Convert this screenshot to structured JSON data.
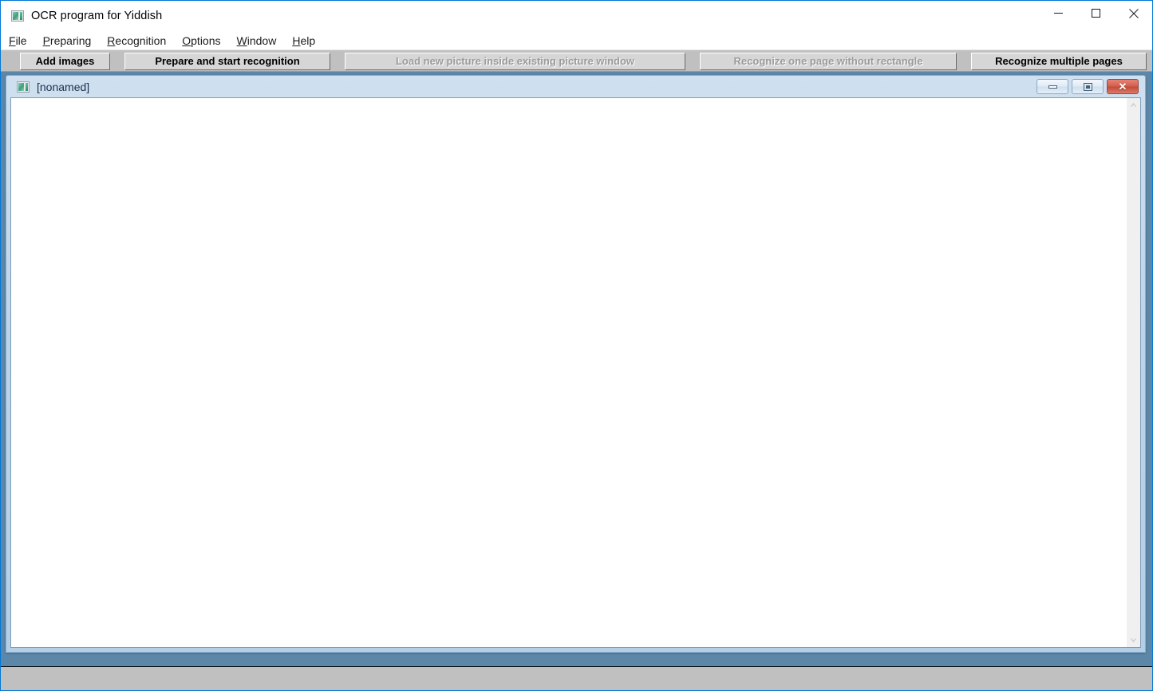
{
  "window": {
    "title": "OCR program for Yiddish",
    "icon": "picture-icon",
    "controls": [
      {
        "name": "minimize",
        "glyph": "—"
      },
      {
        "name": "maximize",
        "glyph": "□"
      },
      {
        "name": "close",
        "glyph": "✕"
      }
    ]
  },
  "menubar": {
    "items": [
      {
        "label": "File",
        "accel": "F"
      },
      {
        "label": "Preparing",
        "accel": "P"
      },
      {
        "label": "Recognition",
        "accel": "R"
      },
      {
        "label": "Options",
        "accel": "O"
      },
      {
        "label": "Window",
        "accel": "W"
      },
      {
        "label": "Help",
        "accel": "H"
      }
    ]
  },
  "toolbar": {
    "buttons": [
      {
        "label": "Add images",
        "enabled": true
      },
      {
        "label": "Prepare and start recognition",
        "enabled": true
      },
      {
        "label": "Load new picture inside existing picture window",
        "enabled": false
      },
      {
        "label": "Recognize one page without rectangle",
        "enabled": false
      },
      {
        "label": "Recognize multiple pages",
        "enabled": true
      }
    ]
  },
  "mdi_child": {
    "title": "[nonamed]",
    "icon": "picture-icon",
    "controls": [
      {
        "name": "minimize",
        "glyph": ""
      },
      {
        "name": "restore",
        "glyph": ""
      },
      {
        "name": "close",
        "glyph": "✕"
      }
    ],
    "document": {
      "content": "",
      "scrollbar": {
        "up_arrow": "▲",
        "down_arrow": "▼"
      }
    }
  },
  "statusbar": {
    "text": ""
  },
  "colors": {
    "accent_border": "#0078d7",
    "toolbar_face": "#c0c0c0",
    "mdi_backdrop": "#5d87a8",
    "mdi_titlebar": "#bcd4ea",
    "close_button": "#c24a38",
    "disabled_text": "#9b9b9b"
  }
}
